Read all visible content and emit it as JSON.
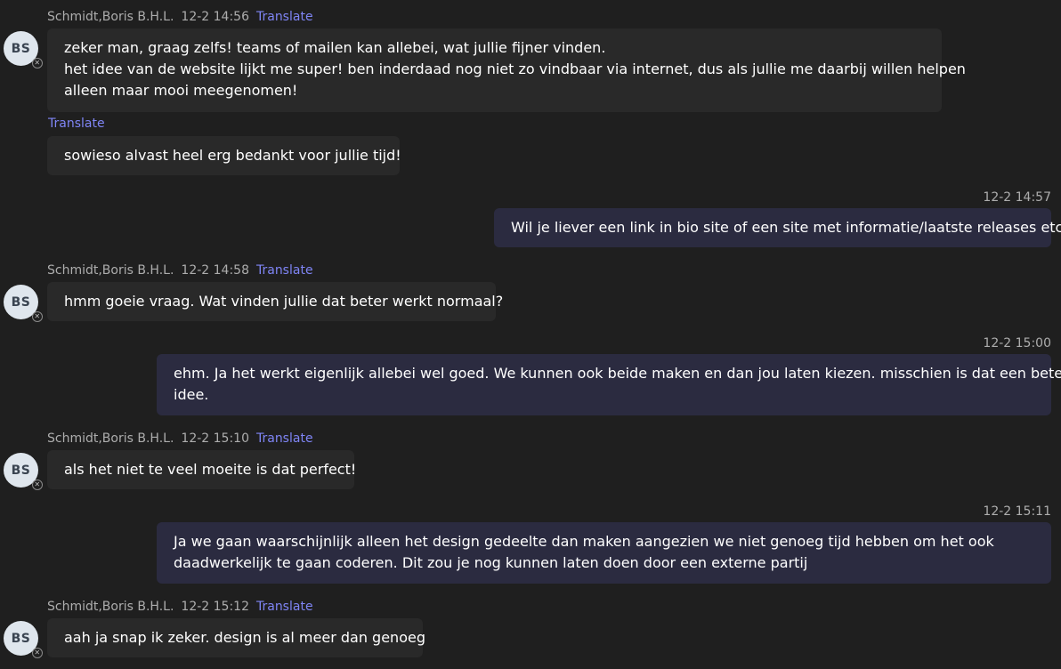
{
  "sender": {
    "name": "Schmidt,Boris B.H.L.",
    "initials": "BS",
    "presence_icon": "offline-x-icon"
  },
  "translate_label": "Translate",
  "messages": [
    {
      "time": "12-2 14:56",
      "lines": [
        "zeker man, graag zelfs! teams of mailen kan allebei, wat jullie fijner vinden.",
        "het idee van de website lijkt me super! ben inderdaad nog niet zo vindbaar via internet, dus als jullie me daarbij willen helpen",
        "alleen maar mooi meegenomen!"
      ]
    },
    {
      "lines": [
        "sowieso alvast heel erg bedankt voor jullie tijd!"
      ]
    },
    {
      "time": "12-2 14:57",
      "lines": [
        "Wil je liever een link in bio site of een site met informatie/laatste releases etc."
      ]
    },
    {
      "time": "12-2 14:58",
      "lines": [
        "hmm goeie vraag. Wat vinden jullie dat beter werkt normaal?"
      ]
    },
    {
      "time": "12-2 15:00",
      "lines": [
        "ehm. Ja het werkt eigenlijk allebei wel goed. We kunnen ook beide maken en dan jou laten kiezen. misschien is dat een beter",
        "idee."
      ]
    },
    {
      "time": "12-2 15:10",
      "lines": [
        "als het niet te veel moeite is dat perfect!"
      ]
    },
    {
      "time": "12-2 15:11",
      "lines": [
        "Ja we gaan waarschijnlijk alleen het design gedeelte dan maken aangezien we niet genoeg tijd hebben om het ook",
        "daadwerkelijk te gaan coderen. Dit zou je nog kunnen laten doen door een externe partij"
      ]
    },
    {
      "time": "12-2 15:12",
      "lines": [
        "aah ja snap ik zeker. design is al meer dan genoeg"
      ]
    }
  ]
}
